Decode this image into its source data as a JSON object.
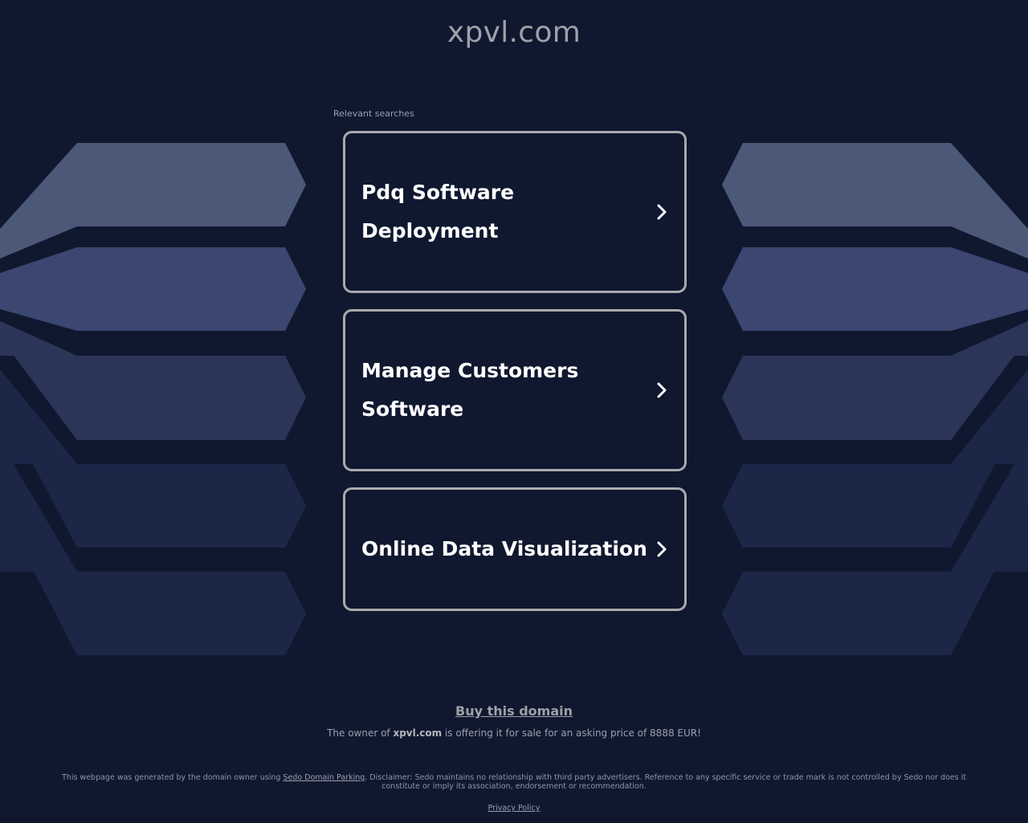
{
  "header": {
    "domain": "xpvl.com"
  },
  "searches": {
    "label": "Relevant searches",
    "items": [
      {
        "label": "Pdq Software Deployment"
      },
      {
        "label": "Manage Customers Software"
      },
      {
        "label": "Online Data Visualization"
      }
    ]
  },
  "sale": {
    "buy_label": "Buy this domain",
    "offer_prefix": "The owner of ",
    "offer_domain": "xpvl.com",
    "offer_suffix": " is offering it for sale for an asking price of 8888 EUR!"
  },
  "footer": {
    "disclaimer_prefix": "This webpage was generated by the domain owner using ",
    "sedo_link": "Sedo Domain Parking",
    "disclaimer_suffix": ". Disclaimer: Sedo maintains no relationship with third party advertisers. Reference to any specific service or trade mark is not controlled by Sedo nor does it constitute or imply its association, endorsement or recommendation.",
    "privacy_label": "Privacy Policy"
  },
  "colors": {
    "background": "#101830",
    "card_border": "#a9aaad",
    "card_text": "#ffffff",
    "muted_text": "#9aa0ab"
  },
  "icons": {
    "card_chevron": "chevron-right-icon"
  }
}
